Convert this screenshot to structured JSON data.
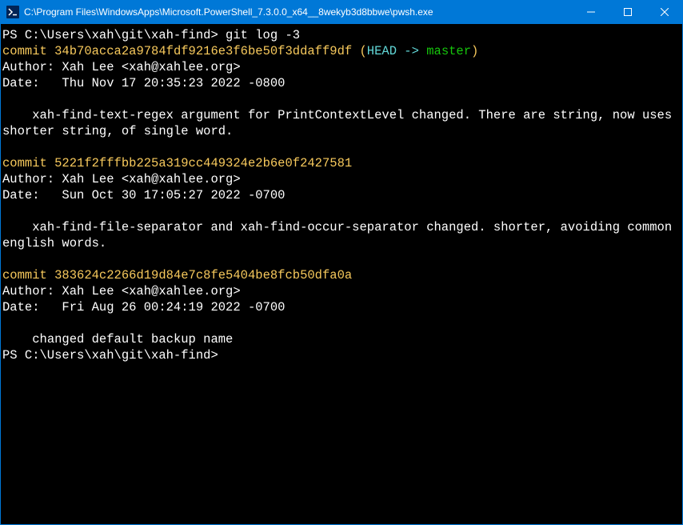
{
  "window": {
    "title": "C:\\Program Files\\WindowsApps\\Microsoft.PowerShell_7.3.0.0_x64__8wekyb3d8bbwe\\pwsh.exe"
  },
  "terminal": {
    "prompt1": "PS C:\\Users\\xah\\git\\xah-find> ",
    "command": "git log -3",
    "commits": [
      {
        "hash_label": "commit ",
        "hash": "34b70acca2a9784fdf9216e3f6be50f3ddaff9df",
        "ref_open": " (",
        "ref_head": "HEAD -> ",
        "ref_branch": "master",
        "ref_close": ")",
        "author": "Author: Xah Lee <xah@xahlee.org>",
        "date": "Date:   Thu Nov 17 20:35:23 2022 -0800",
        "message": "    xah-find-text-regex argument for PrintContextLevel changed. There are string, now uses shorter string, of single word."
      },
      {
        "hash_label": "commit ",
        "hash": "5221f2fffbb225a319cc449324e2b6e0f2427581",
        "author": "Author: Xah Lee <xah@xahlee.org>",
        "date": "Date:   Sun Oct 30 17:05:27 2022 -0700",
        "message": "    xah-find-file-separator and xah-find-occur-separator changed. shorter, avoiding common english words."
      },
      {
        "hash_label": "commit ",
        "hash": "383624c2266d19d84e7c8fe5404be8fcb50dfa0a",
        "author": "Author: Xah Lee <xah@xahlee.org>",
        "date": "Date:   Fri Aug 26 00:24:19 2022 -0700",
        "message": "    changed default backup name"
      }
    ],
    "prompt2": "PS C:\\Users\\xah\\git\\xah-find>"
  }
}
